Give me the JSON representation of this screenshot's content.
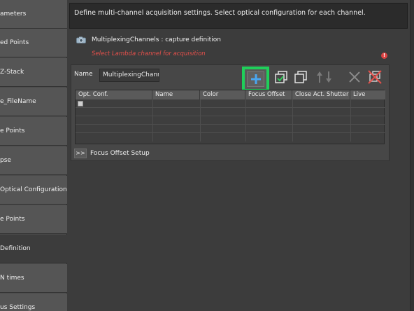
{
  "sidebar": {
    "items": [
      {
        "label": "ameters"
      },
      {
        "label": "ed Points"
      },
      {
        "label": "Z-Stack"
      },
      {
        "label": "e_FileName"
      },
      {
        "label": "e Points"
      },
      {
        "label": "pse"
      },
      {
        "label": "Optical Configuration"
      },
      {
        "label": "e Points"
      },
      {
        "label": "Definition"
      },
      {
        "label": "N times"
      },
      {
        "label": "us Settings"
      }
    ]
  },
  "description": "Define multi-channel acquisition settings. Select optical configuration for each channel.",
  "capture": {
    "title": "MultiplexingChannels : capture definition",
    "warning": "Select Lambda channel for acquisition",
    "error_mark": "!"
  },
  "name_field": {
    "label": "Name",
    "value": "MultiplexingChanne"
  },
  "toolbar": {
    "icons": [
      "add-icon",
      "checked-copy-icon",
      "copy-icon",
      "move-up-down-icon",
      "delete-icon",
      "delete-all-icon"
    ]
  },
  "grid": {
    "columns": [
      "Opt. Conf.",
      "Name",
      "Color",
      "Focus Offset",
      "Close Act. Shutter",
      "Live"
    ],
    "rows": [
      {
        "checkbox": true
      },
      {},
      {},
      {},
      {}
    ]
  },
  "focus_offset": {
    "button": ">>",
    "label": "Focus Offset Setup"
  },
  "colors": {
    "add_highlight": "#1fcf5a",
    "add_plus": "#4aa6f0",
    "warning_text": "#e5504b"
  }
}
